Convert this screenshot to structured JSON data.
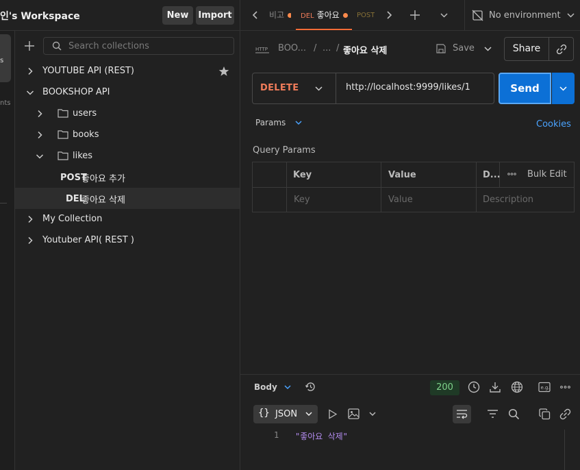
{
  "workspace": {
    "title": "인's Workspace",
    "new_label": "New",
    "import_label": "Import"
  },
  "tabs": {
    "prev_partial": "비고",
    "active": {
      "method": "DEL",
      "name": "좋아요"
    },
    "next_partial": "POST"
  },
  "environment": {
    "label": "No environment"
  },
  "rail": {
    "item1": "s",
    "item2": "nts"
  },
  "sidebar": {
    "search_placeholder": "Search collections",
    "tree": [
      {
        "label": "YOUTUBE API (REST)",
        "starred": true
      },
      {
        "label": "BOOKSHOP API"
      },
      {
        "label": "users"
      },
      {
        "label": "books"
      },
      {
        "label": "likes"
      },
      {
        "method": "POST",
        "label": "좋아요 추가"
      },
      {
        "method": "DEL",
        "label": "좋아요 삭제",
        "selected": true
      },
      {
        "label": "My Collection"
      },
      {
        "label": "Youtuber API( REST )"
      }
    ]
  },
  "request": {
    "breadcrumb": {
      "root": "BOO...",
      "sep": "/",
      "mid": "...",
      "name": "좋아요 삭제"
    },
    "save_label": "Save",
    "share_label": "Share",
    "method": "DELETE",
    "url": "http://localhost:9999/likes/1",
    "send_label": "Send",
    "params_label": "Params",
    "cookies_label": "Cookies",
    "query_params_title": "Query Params",
    "table": {
      "headers": {
        "key": "Key",
        "value": "Value",
        "desc": "D...",
        "bulk_edit": "Bulk Edit"
      },
      "placeholders": {
        "key": "Key",
        "value": "Value",
        "desc": "Description"
      }
    }
  },
  "response": {
    "body_label": "Body",
    "status": "200",
    "format_label": "JSON",
    "line_number": "1",
    "content": "\"좋아요 삭제\""
  },
  "colors": {
    "accent_orange": "#ff6c37",
    "del_method": "#f07c5a",
    "post_method": "#e0b84c",
    "send_blue": "#0c70d6",
    "cookies_blue": "#4aa3ff",
    "status_green": "#7fd38b"
  }
}
